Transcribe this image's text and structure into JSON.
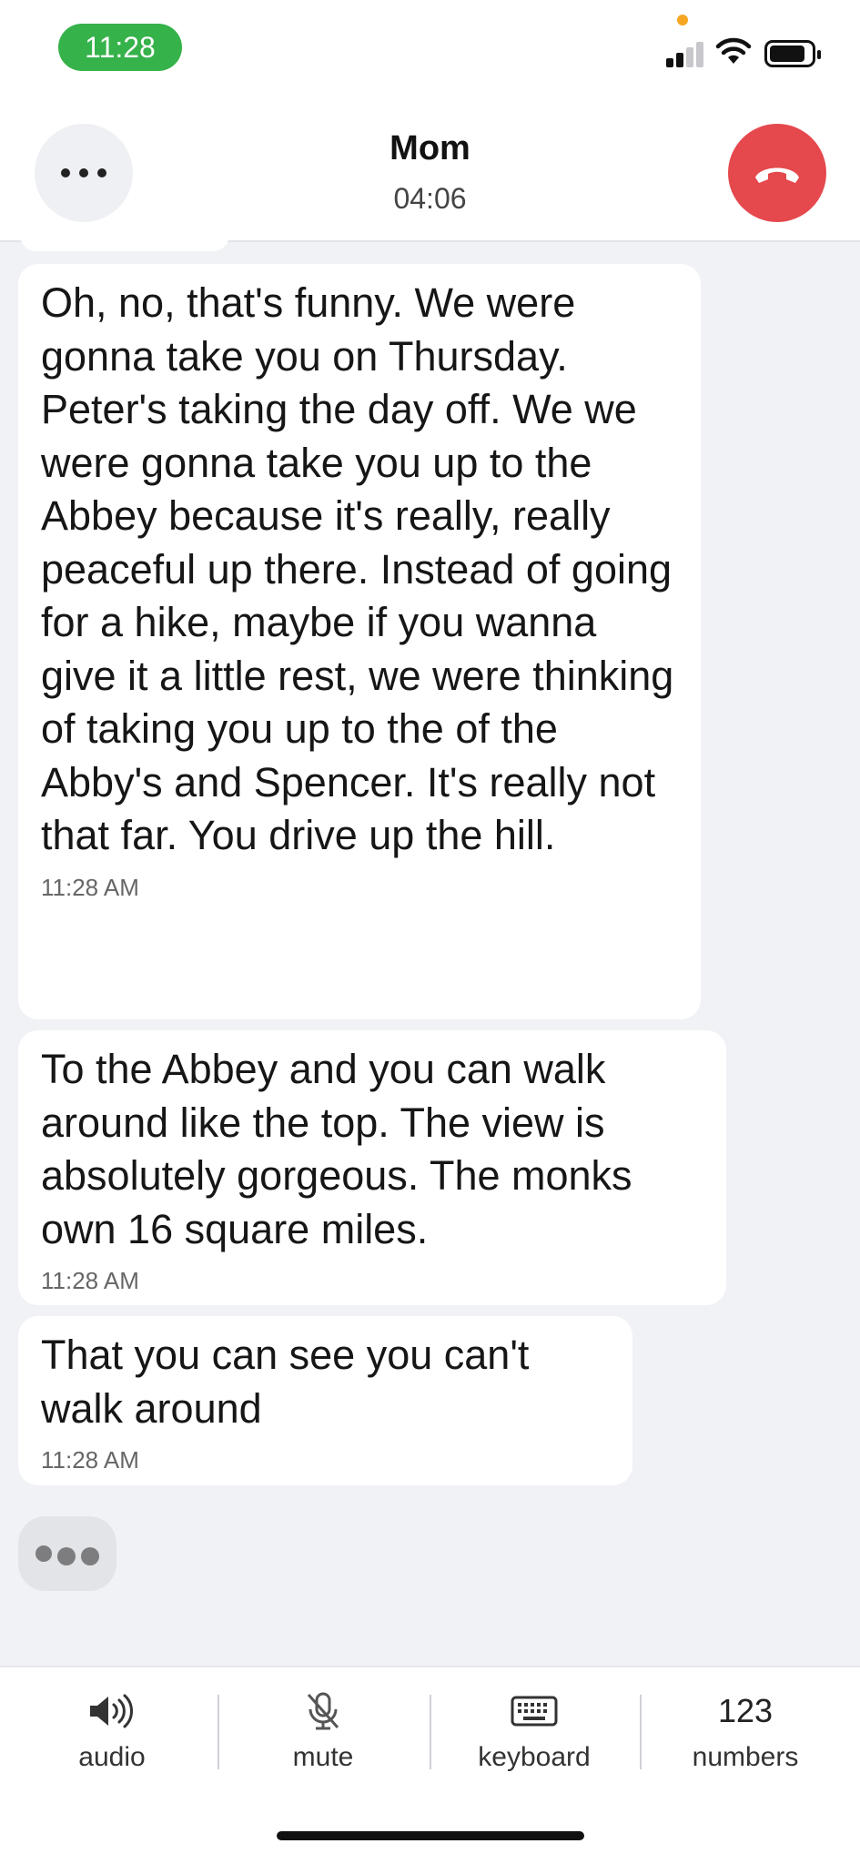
{
  "status_bar": {
    "time": "11:28",
    "time_pill_color": "#36b24a"
  },
  "header": {
    "contact_name": "Mom",
    "call_duration": "04:06",
    "more_icon": "more-dots-icon",
    "hangup_icon": "hangup-phone-icon",
    "hangup_color": "#e5484d"
  },
  "messages": [
    {
      "text": "Oh, no, that's funny. We were gonna take you on Thursday. Peter's taking the day off. We we were gonna take you up to the Abbey because it's really, really peaceful up there. Instead of going for a hike, maybe if you wanna give it a little rest, we were thinking of taking you up to the of the Abby's and Spencer. It's really not that far. You drive up the hill.",
      "time": "11:28 AM"
    },
    {
      "text": "To the Abbey and you can walk around like the top. The view is absolutely gorgeous. The monks own 16 square miles.",
      "time": "11:28 AM"
    },
    {
      "text": "That you can see you can't walk around",
      "time": "11:28 AM"
    }
  ],
  "typing_indicator": "typing-dots-icon",
  "toolbar": {
    "audio": {
      "label": "audio",
      "icon": "speaker-icon"
    },
    "mute": {
      "label": "mute",
      "icon": "mic-off-icon"
    },
    "keyboard": {
      "label": "keyboard",
      "icon": "keyboard-icon"
    },
    "numbers": {
      "label": "numbers",
      "glyph": "123"
    }
  }
}
